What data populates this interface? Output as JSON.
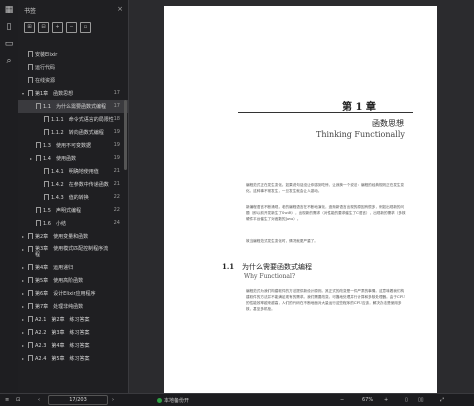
{
  "sidebar": {
    "title": "书签",
    "close": "×",
    "items": [
      {
        "label": "安装Elixir",
        "page": "",
        "indent": 0,
        "arrow": ""
      },
      {
        "label": "运行代码",
        "page": "",
        "indent": 0,
        "arrow": ""
      },
      {
        "label": "在线资源",
        "page": "",
        "indent": 0,
        "arrow": ""
      },
      {
        "label": "第1章　函数思想",
        "page": "17",
        "indent": 0,
        "arrow": "▾"
      },
      {
        "label": "1.1　为什么需要函数式编程",
        "page": "17",
        "indent": 1,
        "arrow": "",
        "active": true
      },
      {
        "label": "1.1.1　命令式语言的局限性",
        "page": "18",
        "indent": 2,
        "arrow": ""
      },
      {
        "label": "1.1.2　转向函数式编程",
        "page": "19",
        "indent": 2,
        "arrow": ""
      },
      {
        "label": "1.3　使用不可变数据",
        "page": "19",
        "indent": 1,
        "arrow": ""
      },
      {
        "label": "1.4　使用函数",
        "page": "19",
        "indent": 1,
        "arrow": "▸"
      },
      {
        "label": "1.4.1　明确地使用值",
        "page": "21",
        "indent": 2,
        "arrow": ""
      },
      {
        "label": "1.4.2　在参数中传递函数",
        "page": "21",
        "indent": 2,
        "arrow": ""
      },
      {
        "label": "1.4.3　值的转换",
        "page": "22",
        "indent": 2,
        "arrow": ""
      },
      {
        "label": "1.5　声明式编程",
        "page": "22",
        "indent": 1,
        "arrow": ""
      },
      {
        "label": "1.6　小结",
        "page": "24",
        "indent": 1,
        "arrow": ""
      },
      {
        "label": "第2章　使用变量和函数",
        "page": "",
        "indent": 0,
        "arrow": "▸"
      },
      {
        "label": "第3章　使用模式匹配控制程序流程",
        "page": "",
        "indent": 0,
        "arrow": "▸",
        "two": true
      },
      {
        "label": "第4章　运用递归",
        "page": "",
        "indent": 0,
        "arrow": "▸"
      },
      {
        "label": "第5章　使用高阶函数",
        "page": "",
        "indent": 0,
        "arrow": "▸"
      },
      {
        "label": "第6章　设计Elixir应用程序",
        "page": "",
        "indent": 0,
        "arrow": "▸"
      },
      {
        "label": "第7章　处理非纯函数",
        "page": "",
        "indent": 0,
        "arrow": "▸"
      },
      {
        "label": "A2.1　第2章　练习答案",
        "page": "",
        "indent": 0,
        "arrow": "▸"
      },
      {
        "label": "A2.2　第3章　练习答案",
        "page": "",
        "indent": 0,
        "arrow": "▸"
      },
      {
        "label": "A2.3　第4章　练习答案",
        "page": "",
        "indent": 0,
        "arrow": "▸"
      },
      {
        "label": "A2.4　第5章　练习答案",
        "page": "",
        "indent": 0,
        "arrow": "▸"
      }
    ]
  },
  "page": {
    "chapter_num": "第 1 章",
    "chapter_cn": "函数思想",
    "chapter_en": "Thinking Functionally",
    "para1": "编程范式正在发生变化。如果说句话没让你感到吃惊，让我换一个说法：编程的经典规则正在发生变化。这种事不常发生，一旦发生就会让人激动。",
    "para2": "新编程语言不断涌现，老的编程语言在不断地演化，逐渐新语言出现的原因有很多，例如出现新的问题（即以前开发新生了Swift），出现新的需求（对性能的要求催生了C语言），出现新的需求（多核硬件平台催生了对函数的Java）。",
    "para3": "故当编程范式发生变化时，情况就更严重了。",
    "section_num": "1.1",
    "section_cn": "为什么需要函数式编程",
    "section_en": "Why Functional?",
    "para4": "编程范式为我们构建软件的方法提供新设计原则。其正式的改变是一件严肃的事情。这意味着我们构建软件的方法并不能满足现有的需求。我们需要改变。可靠地处理并行计算和多核处理器。由于CPU的性能效率越来越高，人们的代码在不断地面对大量运行这些程序的CPU应该，解决办法是使用多核，甚至多机柜。"
  },
  "status": {
    "page_value": "17/203",
    "backup": "本地备份开",
    "zoom": "67%",
    "prev": "‹",
    "next": "›"
  }
}
